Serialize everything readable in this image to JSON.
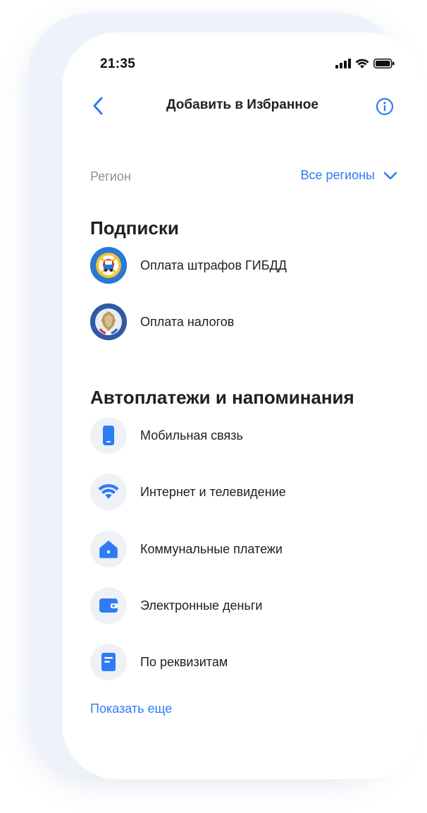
{
  "status_bar": {
    "time": "21:35"
  },
  "navbar": {
    "title": "Добавить в Избранное"
  },
  "region": {
    "label": "Регион",
    "value": "Все регионы"
  },
  "subscriptions": {
    "title": "Подписки",
    "items": [
      {
        "label": "Оплата штрафов ГИБДД",
        "icon": "gibdd-emblem-icon"
      },
      {
        "label": "Оплата налогов",
        "icon": "tax-service-emblem-icon"
      }
    ]
  },
  "autopayments": {
    "title": "Автоплатежи и напоминания",
    "items": [
      {
        "label": "Мобильная связь",
        "icon": "mobile-phone-icon"
      },
      {
        "label": "Интернет и телевидение",
        "icon": "wifi-icon"
      },
      {
        "label": "Коммунальные платежи",
        "icon": "house-icon"
      },
      {
        "label": "Электронные деньги",
        "icon": "wallet-icon"
      },
      {
        "label": "По реквизитам",
        "icon": "document-icon"
      }
    ]
  },
  "show_more": "Показать еще",
  "colors": {
    "accent": "#2f7bf5",
    "icon_bg": "#eef1f6",
    "secondary_text": "#8a909c"
  }
}
